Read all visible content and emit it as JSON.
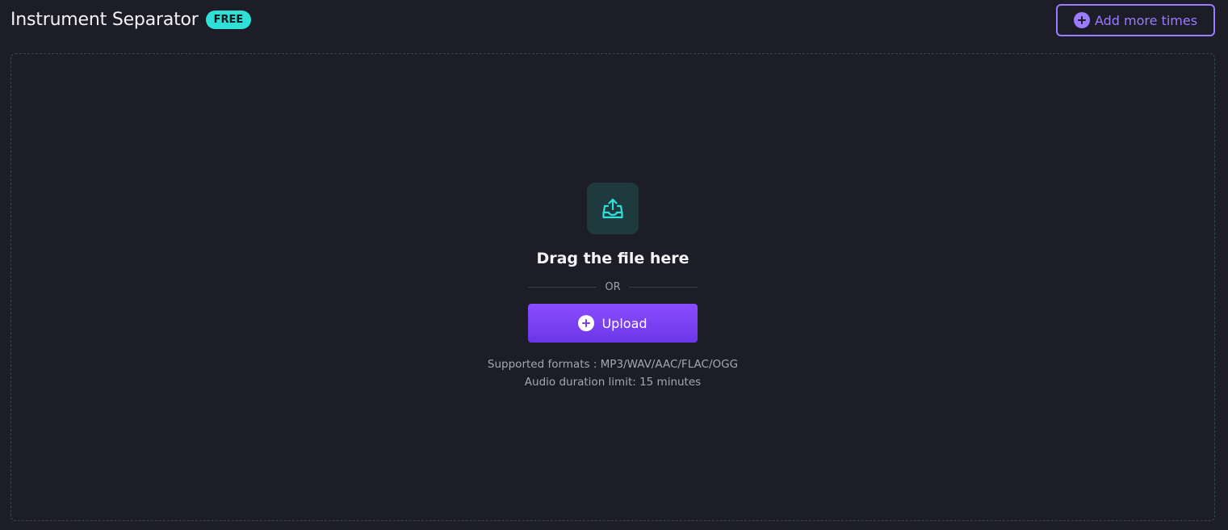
{
  "header": {
    "title": "Instrument Separator",
    "badge": "FREE"
  },
  "actions": {
    "add_more_label": "Add more times"
  },
  "dropzone": {
    "drag_text": "Drag the file here",
    "or_text": "OR",
    "upload_label": "Upload",
    "supported_formats": "Supported formats : MP3/WAV/AAC/FLAC/OGG",
    "duration_limit": "Audio duration limit: 15 minutes"
  },
  "colors": {
    "background": "#1c1d26",
    "accent_teal": "#2fe0d6",
    "accent_purple": "#9b7bff",
    "upload_button": "#7a41f5"
  },
  "icons": {
    "add_more": "plus-circle-icon",
    "upload_tray": "upload-tray-icon",
    "upload_button": "plus-circle-icon"
  }
}
